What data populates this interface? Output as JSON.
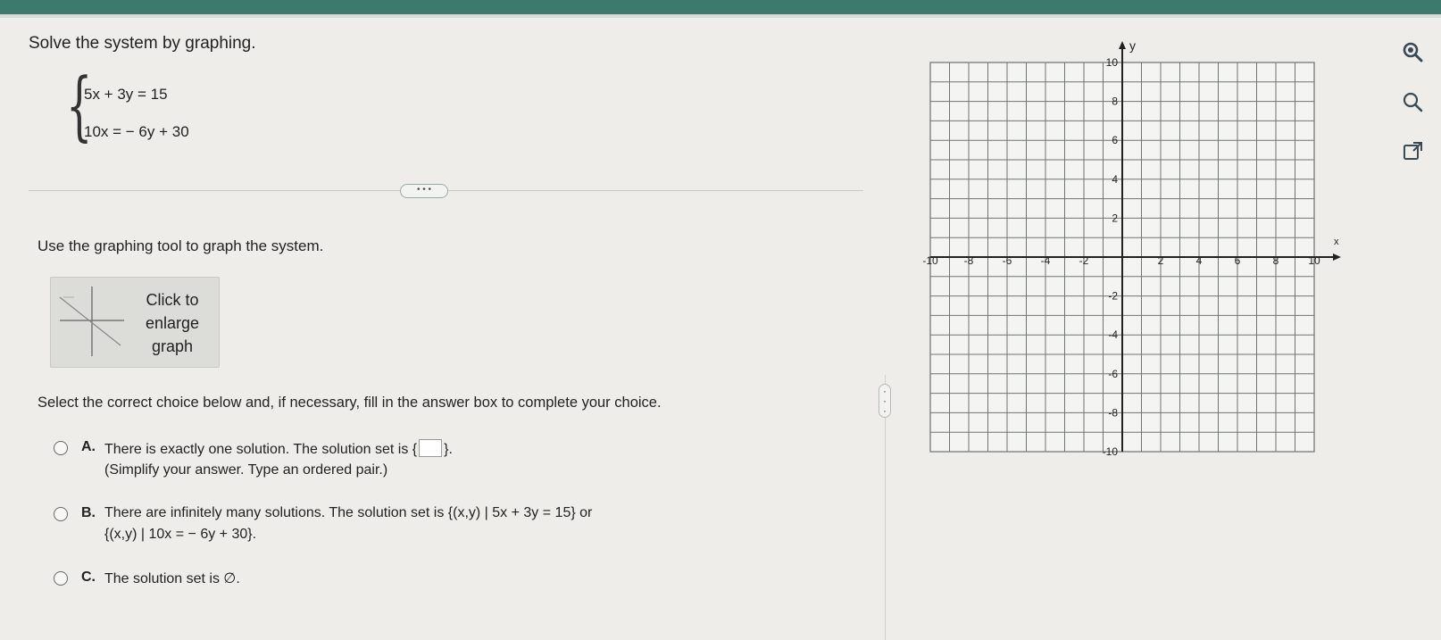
{
  "question": {
    "prompt": "Solve the system by graphing.",
    "equation_1": "5x + 3y = 15",
    "equation_2": "10x = − 6y + 30"
  },
  "more_button": "• • •",
  "instruction": "Use the graphing tool to graph the system.",
  "thumbnail": {
    "line1": "Click to",
    "line2": "enlarge",
    "line3": "graph"
  },
  "select_prompt": "Select the correct choice below and, if necessary, fill in the answer box to complete your choice.",
  "choices": [
    {
      "label": "A.",
      "text_before": "There is exactly one solution. The solution set is {",
      "text_after": "}.",
      "note": "(Simplify your answer. Type an ordered pair.)"
    },
    {
      "label": "B.",
      "text": "There are infinitely many solutions. The solution set is {(x,y) | 5x + 3y = 15} or",
      "text2": "{(x,y) | 10x = − 6y + 30}."
    },
    {
      "label": "C.",
      "text": "The solution set is ∅."
    }
  ],
  "graph": {
    "x_label": "x",
    "y_label": "y",
    "x_ticks": [
      "-10",
      "-8",
      "-6",
      "-4",
      "-2",
      "2",
      "4",
      "6",
      "8",
      "10"
    ],
    "y_ticks": [
      "10",
      "8",
      "6",
      "4",
      "2",
      "-2",
      "-4",
      "-6",
      "-8",
      "-10"
    ],
    "x_range": [
      -10,
      10
    ],
    "y_range": [
      -10,
      10
    ],
    "grid": true
  },
  "side_icons": [
    "zoom-in-icon",
    "zoom-out-icon",
    "external-link-icon"
  ]
}
